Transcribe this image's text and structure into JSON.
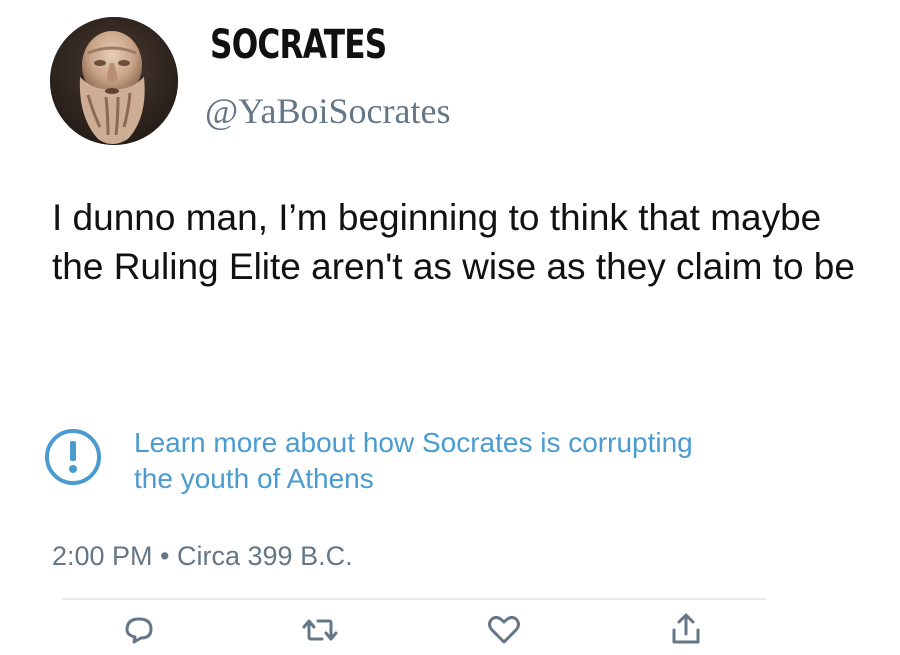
{
  "tweet": {
    "display_name": "SOCRATES",
    "handle": "@YaBoiSocrates",
    "text": "I dunno man, I’m beginning to think that maybe the Ruling Elite aren't as wise as they claim to be",
    "notice": {
      "icon": "exclamation-circle-icon",
      "text": "Learn more about how Socrates is corrupting the youth of Athens",
      "color": "#4a9bd0"
    },
    "timestamp": "2:00 PM • Circa 399 B.C."
  },
  "actions": [
    {
      "icon": "reply-icon"
    },
    {
      "icon": "retweet-icon"
    },
    {
      "icon": "like-icon"
    },
    {
      "icon": "share-icon"
    }
  ],
  "colors": {
    "text": "#111111",
    "secondary": "#657786",
    "link": "#4a9bd0",
    "divider": "#e6ecf0"
  }
}
